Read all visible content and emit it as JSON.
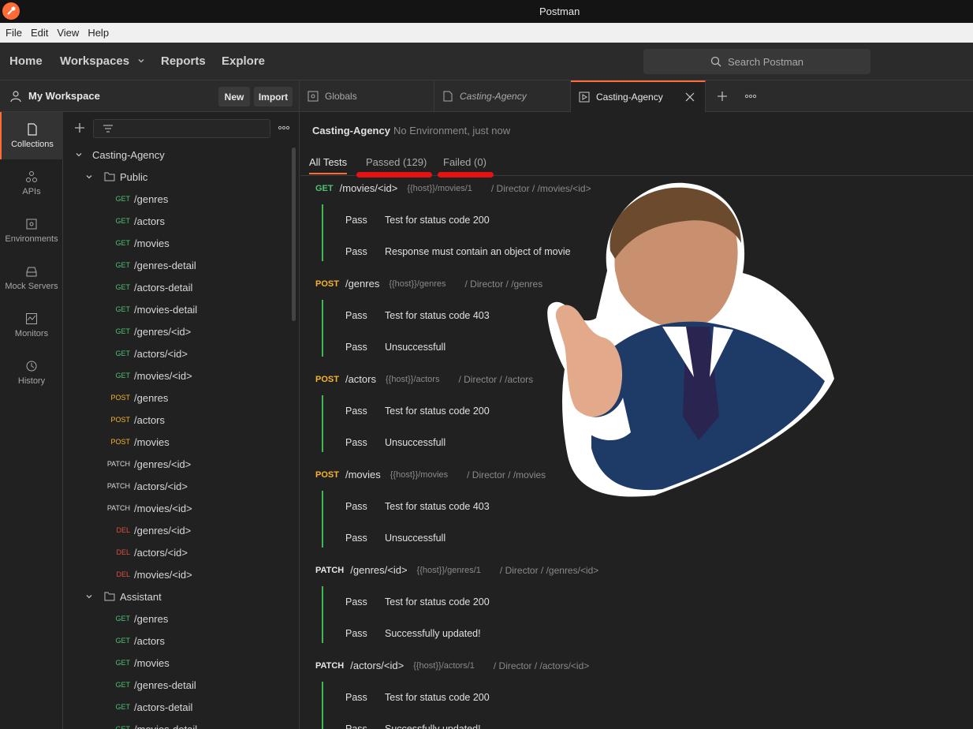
{
  "window": {
    "title": "Postman"
  },
  "menu": [
    "File",
    "Edit",
    "View",
    "Help"
  ],
  "header": {
    "nav": [
      "Home",
      "Workspaces",
      "Reports",
      "Explore"
    ],
    "search_placeholder": "Search Postman"
  },
  "workspace": {
    "name": "My Workspace",
    "new_label": "New",
    "import_label": "Import"
  },
  "rail": [
    {
      "label": "Collections",
      "icon": "collections-icon"
    },
    {
      "label": "APIs",
      "icon": "apis-icon"
    },
    {
      "label": "Environments",
      "icon": "environments-icon"
    },
    {
      "label": "Mock Servers",
      "icon": "mock-servers-icon"
    },
    {
      "label": "Monitors",
      "icon": "monitors-icon"
    },
    {
      "label": "History",
      "icon": "history-icon"
    }
  ],
  "tree": {
    "collection": "Casting-Agency",
    "folders": [
      {
        "name": "Public",
        "items": [
          {
            "m": "GET",
            "p": "/genres"
          },
          {
            "m": "GET",
            "p": "/actors"
          },
          {
            "m": "GET",
            "p": "/movies"
          },
          {
            "m": "GET",
            "p": "/genres-detail"
          },
          {
            "m": "GET",
            "p": "/actors-detail"
          },
          {
            "m": "GET",
            "p": "/movies-detail"
          },
          {
            "m": "GET",
            "p": "/genres/<id>"
          },
          {
            "m": "GET",
            "p": "/actors/<id>"
          },
          {
            "m": "GET",
            "p": "/movies/<id>"
          },
          {
            "m": "POST",
            "p": "/genres"
          },
          {
            "m": "POST",
            "p": "/actors"
          },
          {
            "m": "POST",
            "p": "/movies"
          },
          {
            "m": "PATCH",
            "p": "/genres/<id>"
          },
          {
            "m": "PATCH",
            "p": "/actors/<id>"
          },
          {
            "m": "PATCH",
            "p": "/movies/<id>"
          },
          {
            "m": "DEL",
            "p": "/genres/<id>"
          },
          {
            "m": "DEL",
            "p": "/actors/<id>"
          },
          {
            "m": "DEL",
            "p": "/movies/<id>"
          }
        ]
      },
      {
        "name": "Assistant",
        "items": [
          {
            "m": "GET",
            "p": "/genres"
          },
          {
            "m": "GET",
            "p": "/actors"
          },
          {
            "m": "GET",
            "p": "/movies"
          },
          {
            "m": "GET",
            "p": "/genres-detail"
          },
          {
            "m": "GET",
            "p": "/actors-detail"
          },
          {
            "m": "GET",
            "p": "/movies-detail"
          }
        ]
      }
    ]
  },
  "tabs": [
    {
      "label": "Globals"
    },
    {
      "label": "Casting-Agency"
    },
    {
      "label": "Casting-Agency"
    }
  ],
  "run": {
    "title": "Casting-Agency",
    "subtitle": "No Environment, just now",
    "tabs": [
      "All Tests",
      "Passed (129)",
      "Failed (0)"
    ]
  },
  "requests": [
    {
      "method": "GET",
      "url": "/movies/<id>",
      "host": "{{host}}/movies/1",
      "path": "/ Director / /movies/<id>",
      "results": [
        {
          "s": "Pass",
          "t": "Test for status code 200"
        },
        {
          "s": "Pass",
          "t": "Response must contain an object of movie"
        }
      ]
    },
    {
      "method": "POST",
      "url": "/genres",
      "host": "{{host}}/genres",
      "path": "/ Director / /genres",
      "results": [
        {
          "s": "Pass",
          "t": "Test for status code 403"
        },
        {
          "s": "Pass",
          "t": "Unsuccessfull"
        }
      ]
    },
    {
      "method": "POST",
      "url": "/actors",
      "host": "{{host}}/actors",
      "path": "/ Director / /actors",
      "results": [
        {
          "s": "Pass",
          "t": "Test for status code 200"
        },
        {
          "s": "Pass",
          "t": "Unsuccessfull"
        }
      ]
    },
    {
      "method": "POST",
      "url": "/movies",
      "host": "{{host}}/movies",
      "path": "/ Director / /movies",
      "results": [
        {
          "s": "Pass",
          "t": "Test for status code 403"
        },
        {
          "s": "Pass",
          "t": "Unsuccessfull"
        }
      ]
    },
    {
      "method": "PATCH",
      "url": "/genres/<id>",
      "host": "{{host}}/genres/1",
      "path": "/ Director / /genres/<id>",
      "results": [
        {
          "s": "Pass",
          "t": "Test for status code 200"
        },
        {
          "s": "Pass",
          "t": "Successfully updated!"
        }
      ]
    },
    {
      "method": "PATCH",
      "url": "/actors/<id>",
      "host": "{{host}}/actors/1",
      "path": "/ Director / /actors/<id>",
      "results": [
        {
          "s": "Pass",
          "t": "Test for status code 200"
        },
        {
          "s": "Pass",
          "t": "Successfully updated!"
        }
      ]
    }
  ],
  "colors": {
    "accent": "#ff6c37",
    "get": "#4ec36f",
    "post": "#f7b32e",
    "del": "#e04e3a",
    "pass_bar": "#3fb950",
    "annotation": "#e31313"
  }
}
